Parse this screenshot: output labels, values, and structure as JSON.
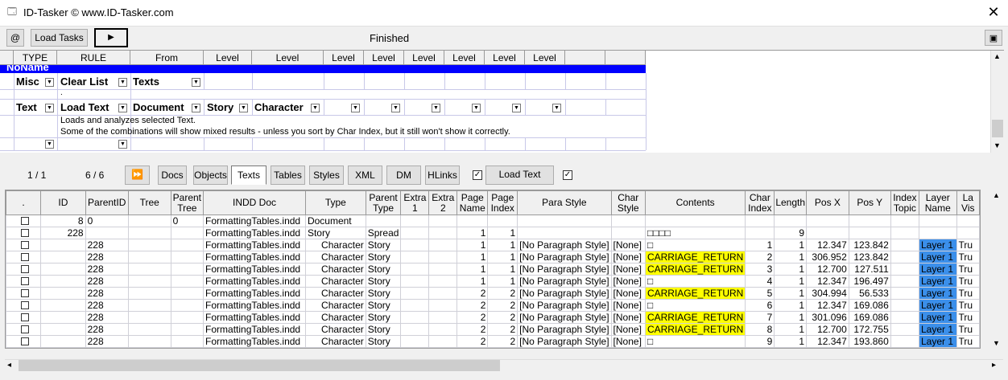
{
  "window": {
    "title": "ID-Tasker  © www.ID-Tasker.com"
  },
  "toolbar": {
    "at_label": "@",
    "load_tasks_label": "Load Tasks",
    "play_label": "▶",
    "status": "Finished",
    "restore_label": "▣"
  },
  "rules": {
    "headers": [
      "TYPE",
      "RULE",
      "From",
      "Level",
      "Level",
      "Level",
      "Level",
      "Level",
      "Level",
      "Level",
      "Level"
    ],
    "group_title": "NoName",
    "row1": {
      "type": "Misc",
      "rule": "Clear List",
      "from": "Texts"
    },
    "row1_note": ".",
    "row2": {
      "type": "Text",
      "rule": "Load Text",
      "from": "Document",
      "level1": "Story",
      "level2": "Character"
    },
    "desc1": "Loads and analyzes selected Text.",
    "desc2": "Some of the combinations will show mixed results - unless you sort by Char Index, but it still won't show it correctly."
  },
  "mid": {
    "count1": "1 / 1",
    "count2": "6 / 6",
    "ff_label": "⏩",
    "tabs": [
      "Docs",
      "Objects",
      "Texts",
      "Tables",
      "Styles",
      "XML",
      "DM",
      "HLinks"
    ],
    "load_text_label": "Load Text"
  },
  "grid": {
    "columns": [
      ".",
      "ID",
      "ParentID",
      "Tree",
      "Parent Tree",
      "INDD Doc",
      "Type",
      "Parent Type",
      "Extra 1",
      "Extra 2",
      "Page Name",
      "Page Index",
      "Para Style",
      "Char Style",
      "Contents",
      "Char Index",
      "Length",
      "Pos X",
      "Pos Y",
      "Index Topic",
      "Layer Name",
      "La Vis"
    ],
    "rows": [
      [
        "",
        "8",
        "0",
        "",
        "0",
        "FormattingTables.indd",
        "Document",
        "",
        "",
        "",
        "",
        "",
        "",
        "",
        "",
        "",
        "",
        "",
        "",
        "",
        "",
        ""
      ],
      [
        "",
        "228",
        "",
        "",
        "",
        "FormattingTables.indd",
        "Story",
        "Spread",
        "",
        "",
        "1",
        "1",
        "",
        "",
        "□□□□",
        "",
        "9",
        "",
        "",
        "",
        "",
        ""
      ],
      [
        "",
        "",
        "228",
        "",
        "",
        "FormattingTables.indd",
        "Character",
        "Story",
        "",
        "",
        "1",
        "1",
        "[No Paragraph Style]",
        "[None]",
        "□",
        "1",
        "1",
        "12.347",
        "123.842",
        "",
        "Layer 1",
        "Tru"
      ],
      [
        "",
        "",
        "228",
        "",
        "",
        "FormattingTables.indd",
        "Character",
        "Story",
        "",
        "",
        "1",
        "1",
        "[No Paragraph Style]",
        "[None]",
        "CARRIAGE_RETURN",
        "2",
        "1",
        "306.952",
        "123.842",
        "",
        "Layer 1",
        "Tru"
      ],
      [
        "",
        "",
        "228",
        "",
        "",
        "FormattingTables.indd",
        "Character",
        "Story",
        "",
        "",
        "1",
        "1",
        "[No Paragraph Style]",
        "[None]",
        "CARRIAGE_RETURN",
        "3",
        "1",
        "12.700",
        "127.511",
        "",
        "Layer 1",
        "Tru"
      ],
      [
        "",
        "",
        "228",
        "",
        "",
        "FormattingTables.indd",
        "Character",
        "Story",
        "",
        "",
        "1",
        "1",
        "[No Paragraph Style]",
        "[None]",
        "□",
        "4",
        "1",
        "12.347",
        "196.497",
        "",
        "Layer 1",
        "Tru"
      ],
      [
        "",
        "",
        "228",
        "",
        "",
        "FormattingTables.indd",
        "Character",
        "Story",
        "",
        "",
        "2",
        "2",
        "[No Paragraph Style]",
        "[None]",
        "CARRIAGE_RETURN",
        "5",
        "1",
        "304.994",
        "56.533",
        "",
        "Layer 1",
        "Tru"
      ],
      [
        "",
        "",
        "228",
        "",
        "",
        "FormattingTables.indd",
        "Character",
        "Story",
        "",
        "",
        "2",
        "2",
        "[No Paragraph Style]",
        "[None]",
        "□",
        "6",
        "1",
        "12.347",
        "169.086",
        "",
        "Layer 1",
        "Tru"
      ],
      [
        "",
        "",
        "228",
        "",
        "",
        "FormattingTables.indd",
        "Character",
        "Story",
        "",
        "",
        "2",
        "2",
        "[No Paragraph Style]",
        "[None]",
        "CARRIAGE_RETURN",
        "7",
        "1",
        "301.096",
        "169.086",
        "",
        "Layer 1",
        "Tru"
      ],
      [
        "",
        "",
        "228",
        "",
        "",
        "FormattingTables.indd",
        "Character",
        "Story",
        "",
        "",
        "2",
        "2",
        "[No Paragraph Style]",
        "[None]",
        "CARRIAGE_RETURN",
        "8",
        "1",
        "12.700",
        "172.755",
        "",
        "Layer 1",
        "Tru"
      ],
      [
        "",
        "",
        "228",
        "",
        "",
        "FormattingTables.indd",
        "Character",
        "Story",
        "",
        "",
        "2",
        "2",
        "[No Paragraph Style]",
        "[None]",
        "□",
        "9",
        "1",
        "12.347",
        "193.860",
        "",
        "Layer 1",
        "Tru"
      ]
    ]
  },
  "colors": {
    "accent_blue": "#0000ff",
    "highlight_yellow": "#ffff00",
    "layer_blue": "#3b8fea"
  }
}
